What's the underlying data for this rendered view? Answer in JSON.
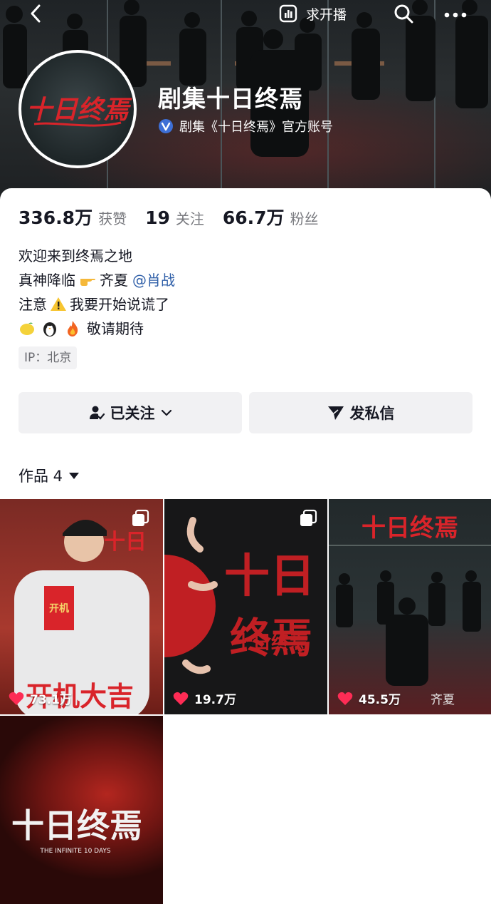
{
  "topbar": {
    "live_label": "求开播",
    "icons": [
      "chevron-left-icon",
      "live-chart-icon",
      "search-icon",
      "more-dots-icon"
    ]
  },
  "profile": {
    "account_name": "剧集十日终焉",
    "verified_text": "剧集《十日终焉》官方账号",
    "avatar_text": "十日终焉",
    "stats": [
      {
        "num": "336.8万",
        "label": "获赞"
      },
      {
        "num": "19",
        "label": "关注"
      },
      {
        "num": "66.7万",
        "label": "粉丝"
      }
    ],
    "bio": {
      "line1": "欢迎来到终焉之地",
      "line2_a": "真神降临",
      "line2_b": "齐夏",
      "line2_mention": "@肖战",
      "line3_a": "注意",
      "line3_b": "我要开始说谎了",
      "line4": "敬请期待"
    },
    "ip": "IP：北京"
  },
  "actions": {
    "follow_label": "已关注",
    "message_label": "发私信"
  },
  "works": {
    "label": "作品 4",
    "items": [
      {
        "likes": "73.1万",
        "title": "开机大吉"
      },
      {
        "likes": "19.7万",
        "title": "十日终焉"
      },
      {
        "likes": "45.5万",
        "title": "十日终焉",
        "caption": "齐夏"
      },
      {
        "likes": "",
        "title": "十日终焉",
        "subtitle": "THE INFINITE 10 DAYS"
      }
    ]
  },
  "colors": {
    "accent_red": "#d9242a",
    "like_pink": "#fe2c55",
    "mention_blue": "#2f5fa8"
  }
}
